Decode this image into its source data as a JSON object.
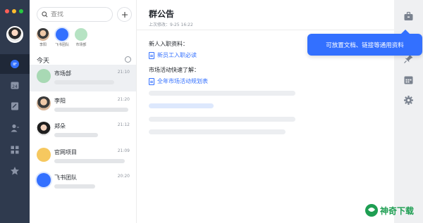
{
  "window": {
    "dots": [
      "#ff5f57",
      "#febc2e",
      "#28c840"
    ]
  },
  "search": {
    "placeholder": "查找"
  },
  "quick_contacts": [
    {
      "label": "李阳",
      "color": "#d9b79a"
    },
    {
      "label": "飞书团队",
      "color": "#3370ff"
    },
    {
      "label": "市场部",
      "color": "#b6e3c3"
    }
  ],
  "list": {
    "section_label": "今天",
    "chats": [
      {
        "name": "市场部",
        "time": "21:10",
        "avatar_icon": "group-icon",
        "avatar_color": "#a8d9b4"
      },
      {
        "name": "李阳",
        "time": "21:20",
        "avatar_icon": "person-avatar",
        "avatar_color": "#d9b79a"
      },
      {
        "name": "郑朵",
        "time": "21:12",
        "avatar_icon": "person-avatar",
        "avatar_color": "#2b2b2b"
      },
      {
        "name": "官网项目",
        "time": "21:09",
        "avatar_icon": "group-icon",
        "avatar_color": "#f6c85f"
      },
      {
        "name": "飞书团队",
        "time": "20:20",
        "avatar_icon": "group-icon",
        "avatar_color": "#3370ff"
      }
    ]
  },
  "main": {
    "title": "群公告",
    "subtitle": "上次修改：9-25 16:22",
    "section1": "新人入职资料：",
    "link1": "新员工入职必读",
    "section2": "市场活动快速了解：",
    "link2": "全年市场活动规划表"
  },
  "tooltip": {
    "text": "可放置文档、链接等通用资料"
  },
  "watermark": {
    "text": "神奇下载"
  },
  "colors": {
    "rail": "#2f3a4e",
    "accent": "#3370ff",
    "tool_panel": "#eff0f2"
  }
}
